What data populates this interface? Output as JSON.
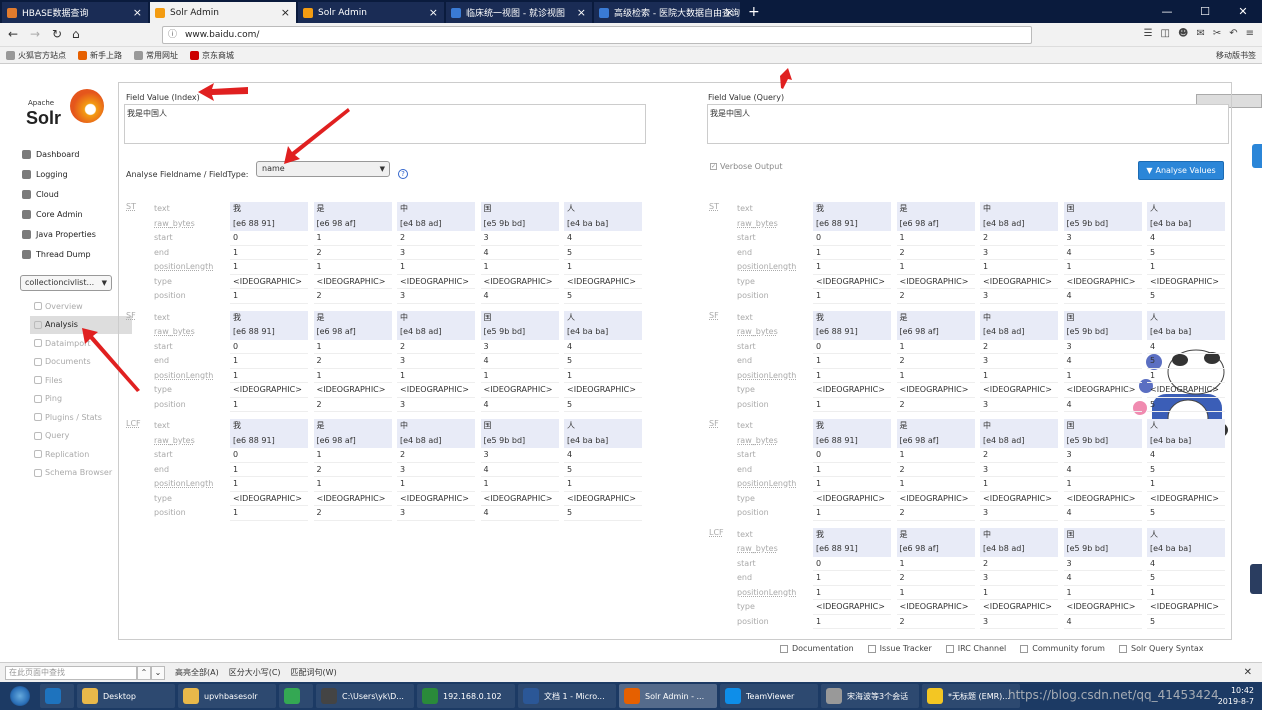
{
  "browser": {
    "tabs": [
      {
        "title": "HBASE数据查询",
        "color": "#e07b2e",
        "active": false
      },
      {
        "title": "Solr Admin",
        "color": "#f39c12",
        "active": true
      },
      {
        "title": "Solr Admin",
        "color": "#f39c12",
        "active": false
      },
      {
        "title": "临床统一视图 - 就诊视图",
        "color": "#3a7bd5",
        "active": false
      },
      {
        "title": "高级检索 - 医院大数据自由查询",
        "color": "#3a7bd5",
        "active": false
      }
    ],
    "new_tab": "+",
    "url": "www.baidu.com/",
    "bookmarks": [
      {
        "label": "火狐官方站点",
        "color": "#999"
      },
      {
        "label": "新手上路",
        "color": "#e66000"
      },
      {
        "label": "常用网址",
        "color": "#999"
      },
      {
        "label": "京东商城",
        "color": "#c00"
      }
    ],
    "mobile_bookmarks": "移动版书签"
  },
  "sidebar": {
    "logo_apache": "Apache",
    "logo_solr": "Solr",
    "menu": [
      {
        "label": "Dashboard",
        "icon": "dashboard-icon"
      },
      {
        "label": "Logging",
        "icon": "logging-icon"
      },
      {
        "label": "Cloud",
        "icon": "cloud-icon"
      },
      {
        "label": "Core Admin",
        "icon": "core-admin-icon"
      },
      {
        "label": "Java Properties",
        "icon": "java-icon"
      },
      {
        "label": "Thread Dump",
        "icon": "thread-icon"
      }
    ],
    "core_selector": "collectioncivlist...",
    "core_menu": [
      {
        "label": "Overview",
        "active": false
      },
      {
        "label": "Analysis",
        "active": true
      },
      {
        "label": "Dataimport",
        "active": false
      },
      {
        "label": "Documents",
        "active": false
      },
      {
        "label": "Files",
        "active": false
      },
      {
        "label": "Ping",
        "active": false
      },
      {
        "label": "Plugins / Stats",
        "active": false
      },
      {
        "label": "Query",
        "active": false
      },
      {
        "label": "Replication",
        "active": false
      },
      {
        "label": "Schema Browser",
        "active": false
      }
    ]
  },
  "analysis": {
    "index_label": "Field Value (Index)",
    "index_value": "我是中国人",
    "query_label": "Field Value (Query)",
    "query_value": "我是中国人",
    "fieldtype_label": "Analyse Fieldname / FieldType:",
    "fieldtype_value": "name",
    "help": "?",
    "verbose_label": "Verbose Output",
    "verbose_check": "✓",
    "analyse_button": "Analyse Values",
    "row_labels": [
      "text",
      "raw_bytes",
      "start",
      "end",
      "positionLength",
      "type",
      "position"
    ],
    "tokens": [
      {
        "text": "我",
        "raw_bytes": "[e6 88 91]",
        "start": "0",
        "end": "1",
        "positionLength": "1",
        "type": "<IDEOGRAPHIC>",
        "position": "1"
      },
      {
        "text": "是",
        "raw_bytes": "[e6 98 af]",
        "start": "1",
        "end": "2",
        "positionLength": "1",
        "type": "<IDEOGRAPHIC>",
        "position": "2"
      },
      {
        "text": "中",
        "raw_bytes": "[e4 b8 ad]",
        "start": "2",
        "end": "3",
        "positionLength": "1",
        "type": "<IDEOGRAPHIC>",
        "position": "3"
      },
      {
        "text": "国",
        "raw_bytes": "[e5 9b bd]",
        "start": "3",
        "end": "4",
        "positionLength": "1",
        "type": "<IDEOGRAPHIC>",
        "position": "4"
      },
      {
        "text": "人",
        "raw_bytes": "[e4 ba ba]",
        "start": "4",
        "end": "5",
        "positionLength": "1",
        "type": "<IDEOGRAPHIC>",
        "position": "5"
      }
    ],
    "index_stages": [
      "ST",
      "SF",
      "LCF"
    ],
    "query_stages": [
      "ST",
      "SF",
      "SF",
      "LCF"
    ]
  },
  "footer": [
    "Documentation",
    "Issue Tracker",
    "IRC Channel",
    "Community forum",
    "Solr Query Syntax"
  ],
  "findbar": {
    "placeholder": "在此页面中查找",
    "highlight_all": "高亮全部(A)",
    "match_case": "区分大小写(C)",
    "whole_words": "匹配词句(W)"
  },
  "taskbar": {
    "items": [
      {
        "label": "",
        "color": "#1e73be"
      },
      {
        "label": "Desktop",
        "color": "#e8b84a"
      },
      {
        "label": "upvhbasesolr",
        "color": "#e8b84a"
      },
      {
        "label": "",
        "color": "#34a853"
      },
      {
        "label": "C:\\Users\\yk\\D...",
        "color": "#444"
      },
      {
        "label": "192.168.0.102",
        "color": "#2a8a3a"
      },
      {
        "label": "文档 1 - Micro...",
        "color": "#2b5797"
      },
      {
        "label": "Solr Admin - ...",
        "color": "#e66000"
      },
      {
        "label": "TeamViewer",
        "color": "#0e8ee9"
      },
      {
        "label": "宋海波等3个会话",
        "color": "#999"
      },
      {
        "label": "*无标题 (EMR)...",
        "color": "#f3c623"
      }
    ],
    "clock_time": "10:42",
    "clock_date": "2019-8-7",
    "watermark": "https://blog.csdn.net/qq_41453424"
  }
}
